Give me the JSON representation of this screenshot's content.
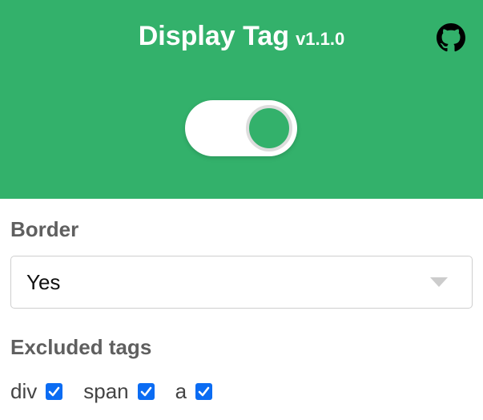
{
  "header": {
    "title": "Display Tag",
    "version": "v1.1.0",
    "background_color": "#33b16b",
    "github_icon": "github-icon",
    "toggle": {
      "state": "on"
    }
  },
  "border": {
    "label": "Border",
    "selected": "Yes"
  },
  "excluded_tags": {
    "label": "Excluded tags",
    "items": [
      {
        "label": "div",
        "checked": true
      },
      {
        "label": "span",
        "checked": true
      },
      {
        "label": "a",
        "checked": true
      }
    ],
    "checkbox_color": "#0b6cf3"
  }
}
